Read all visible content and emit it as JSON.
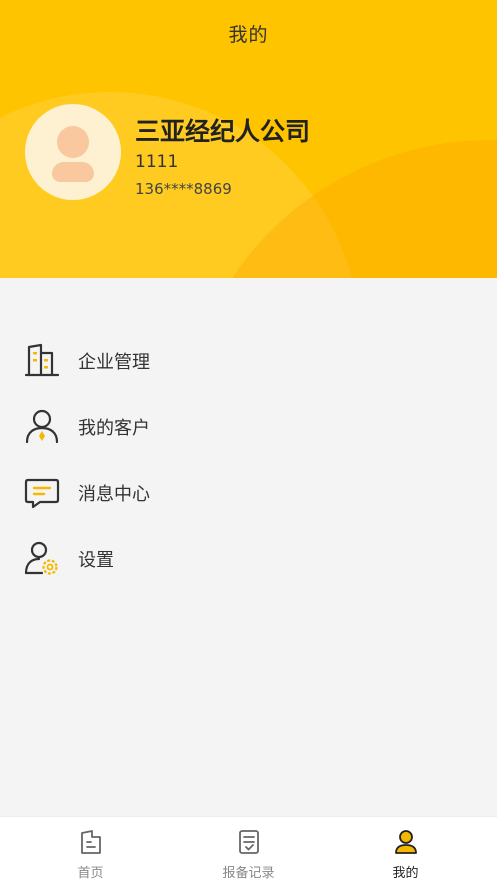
{
  "header": {
    "title": "我的"
  },
  "profile": {
    "company": "三亚经纪人公司",
    "user_id": "1111",
    "phone": "136****8869"
  },
  "menu": [
    {
      "label": "企业管理",
      "icon": "building-icon"
    },
    {
      "label": "我的客户",
      "icon": "customer-icon"
    },
    {
      "label": "消息中心",
      "icon": "message-icon"
    },
    {
      "label": "设置",
      "icon": "settings-icon"
    }
  ],
  "tabs": [
    {
      "label": "首页",
      "icon": "home-icon",
      "active": false
    },
    {
      "label": "报备记录",
      "icon": "record-icon",
      "active": false
    },
    {
      "label": "我的",
      "icon": "user-icon",
      "active": true
    }
  ],
  "colors": {
    "accent": "#ffc400",
    "icon_dark": "#333333",
    "icon_accent": "#f5b800"
  }
}
